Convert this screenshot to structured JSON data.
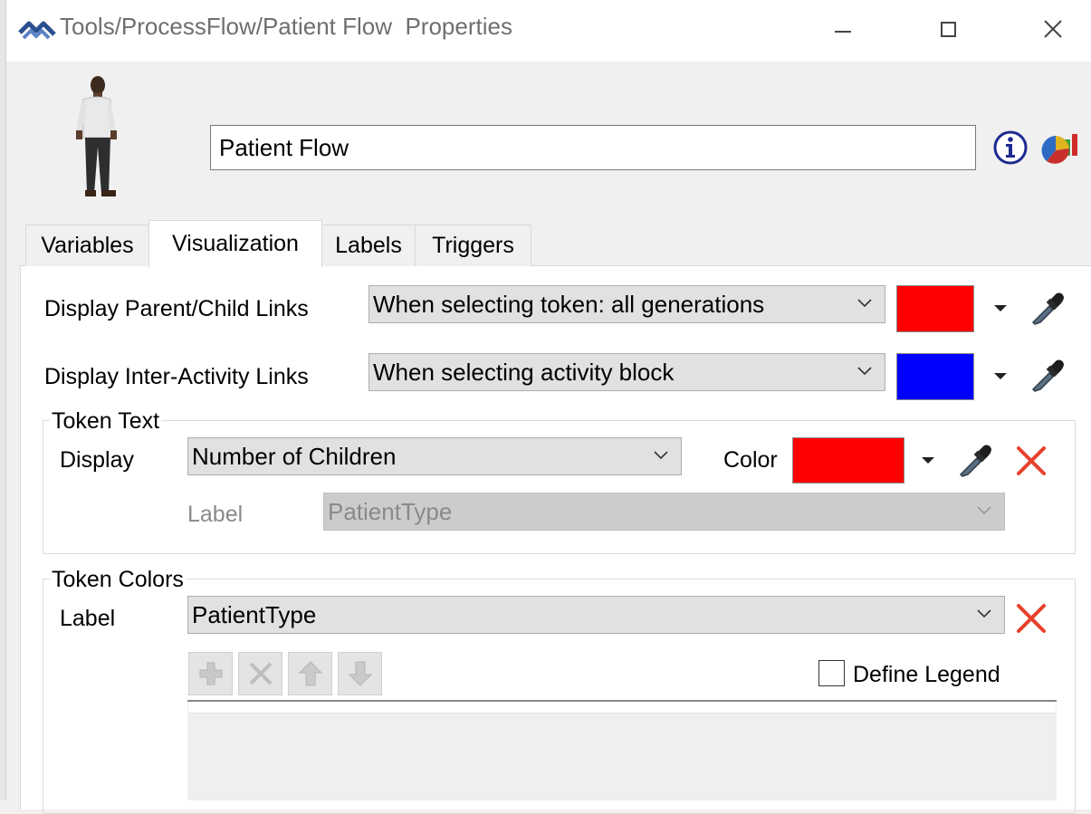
{
  "window": {
    "title": "Tools/ProcessFlow/Patient Flow  Properties",
    "logo_icon": "flexsim-logo-icon",
    "buttons": {
      "minimize": "minimize-icon",
      "maximize": "maximize-icon",
      "close": "close-icon"
    }
  },
  "header": {
    "avatar": "person-figure-icon",
    "name_value": "Patient Flow",
    "info_icon": "info-icon",
    "stats_icon": "statistics-chart-icon"
  },
  "tabs": [
    {
      "label": "Variables"
    },
    {
      "label": "Visualization",
      "active": true
    },
    {
      "label": "Labels"
    },
    {
      "label": "Triggers"
    }
  ],
  "visualization": {
    "parent_child": {
      "label": "Display Parent/Child Links",
      "value": "When selecting token: all generations",
      "color": "#ff0000"
    },
    "inter_activity": {
      "label": "Display Inter-Activity Links",
      "value": "When selecting activity block",
      "color": "#0000ff"
    },
    "token_text": {
      "title": "Token Text",
      "display_label": "Display",
      "display_value": "Number of Children",
      "color_label": "Color",
      "color": "#ff0000",
      "label_label": "Label",
      "label_value": "PatientType"
    },
    "token_colors": {
      "title": "Token Colors",
      "label_label": "Label",
      "label_value": "PatientType",
      "toolbar": [
        "add-icon",
        "remove-icon",
        "move-up-icon",
        "move-down-icon"
      ],
      "define_legend_label": "Define Legend",
      "define_legend_checked": false
    }
  },
  "colors": {
    "clear_x": "#e8412c",
    "accent_info": "#1d2a8f"
  }
}
